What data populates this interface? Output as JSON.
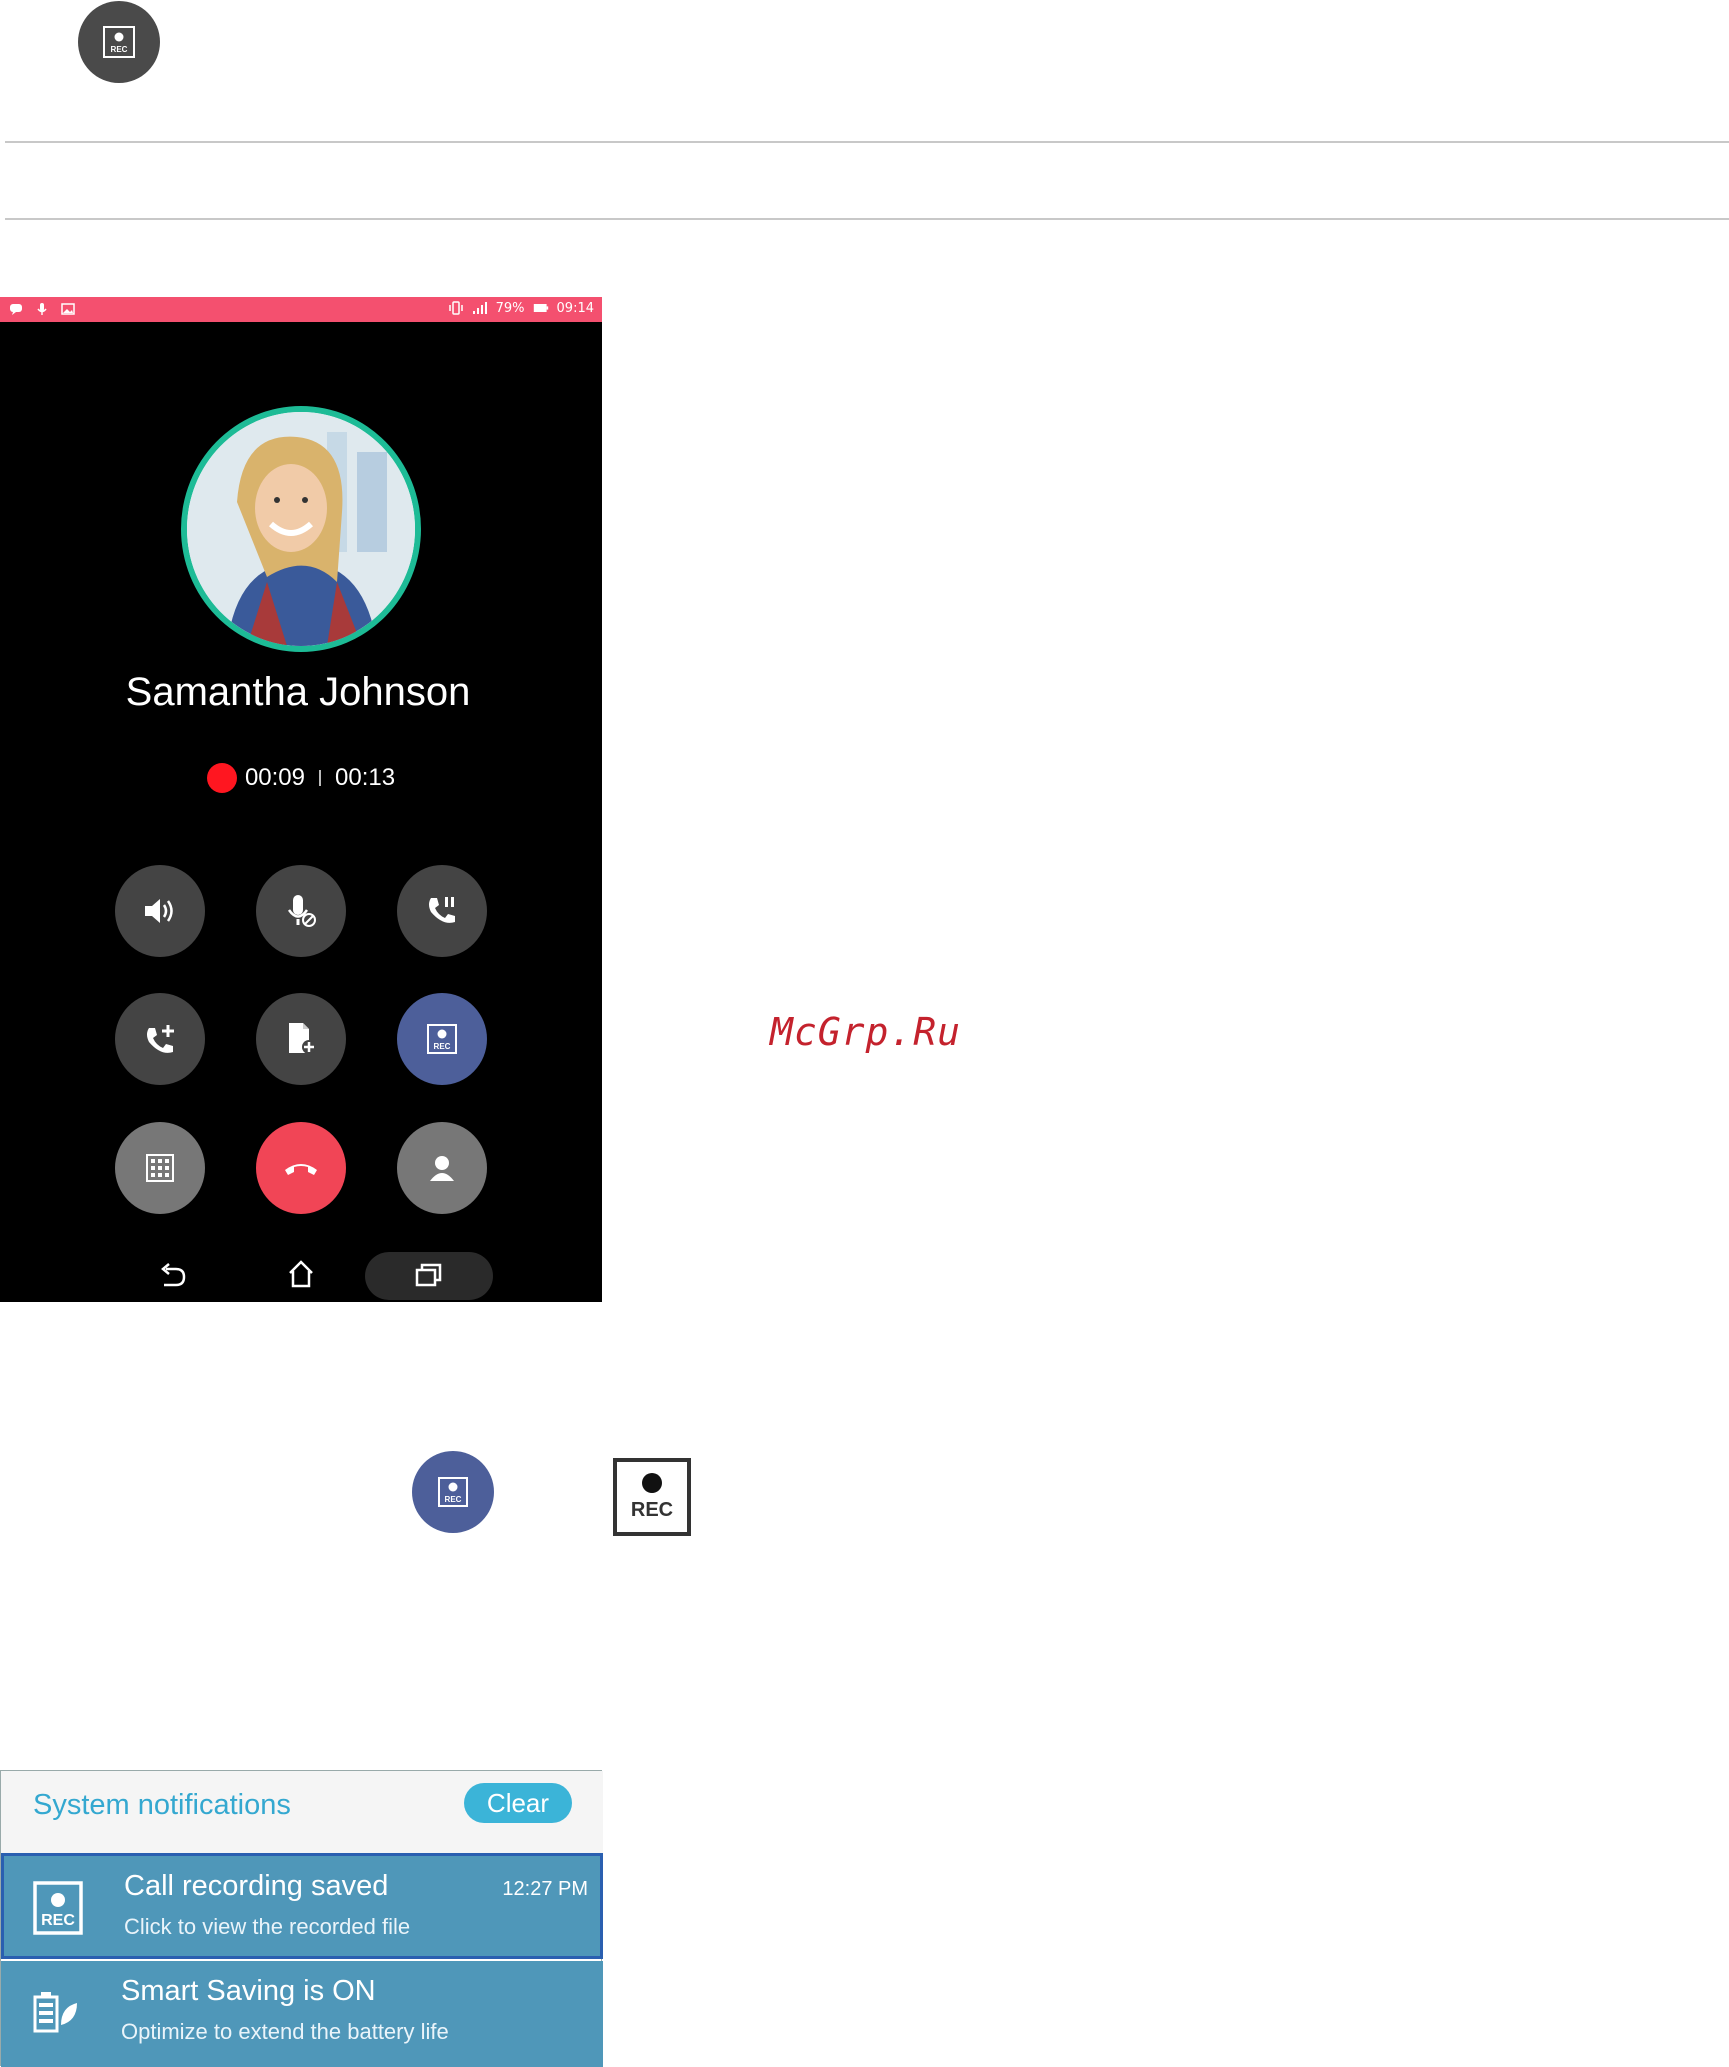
{
  "call": {
    "contact_name": "Samantha Johnson",
    "record_time": "00:09",
    "call_time": "00:13"
  },
  "status_bar": {
    "battery": "79%",
    "clock": "09:14"
  },
  "buttons": {
    "speaker": "speaker-icon",
    "mute": "mute-mic-icon",
    "hold": "hold-call-icon",
    "add_call": "add-call-icon",
    "memo": "add-memo-icon",
    "record": "record-icon",
    "keypad": "keypad-icon",
    "end_call": "end-call-icon",
    "contacts": "contact-icon"
  },
  "rec_label": "REC",
  "watermark": "McGrp.Ru",
  "notifications": {
    "header_title": "System notifications",
    "clear_label": "Clear",
    "items": [
      {
        "title": "Call recording saved",
        "subtitle": "Click to view the recorded file",
        "time": "12:27 PM"
      },
      {
        "title": "Smart Saving is ON",
        "subtitle": "Optimize to extend the battery life",
        "time": ""
      }
    ]
  },
  "colors": {
    "status_bar": "#f4506f",
    "avatar_ring": "#1dbb96",
    "record_button": "#4d5f9a",
    "end_call": "#f14556",
    "notification_row": "#4f97b9",
    "accent_text": "#34a8d0"
  }
}
